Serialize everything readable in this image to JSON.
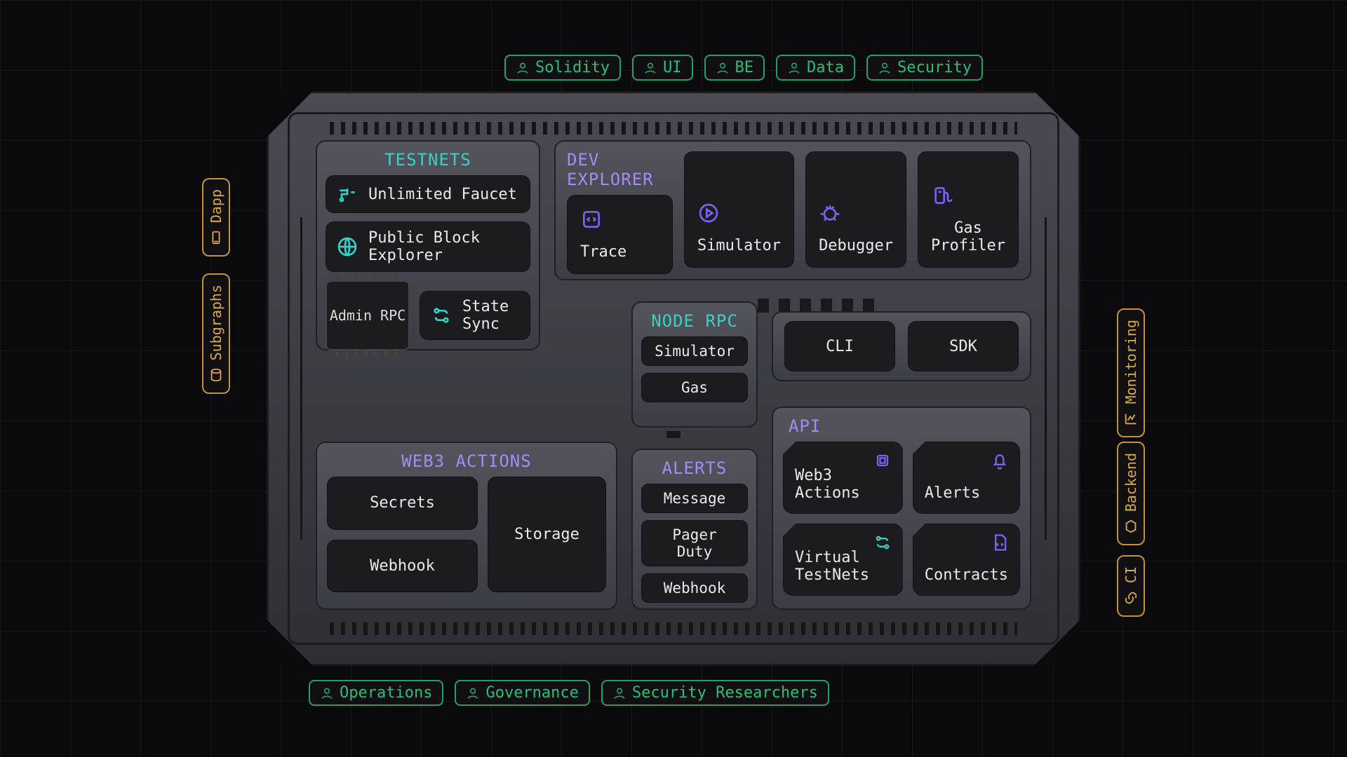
{
  "top_tags": [
    "Solidity",
    "UI",
    "BE",
    "Data",
    "Security"
  ],
  "bottom_tags": [
    "Operations",
    "Governance",
    "Security Researchers"
  ],
  "left_pills": [
    {
      "label": "Dapp",
      "icon": "device"
    },
    {
      "label": "Subgraphs",
      "icon": "db"
    }
  ],
  "right_pills": [
    {
      "label": "Monitoring",
      "icon": "chart"
    },
    {
      "label": "Backend",
      "icon": "hex"
    },
    {
      "label": "CI",
      "icon": "link"
    }
  ],
  "testnets": {
    "title": "TESTNETS",
    "items": [
      "Unlimited Faucet",
      "Public Block Explorer"
    ],
    "admin_rpc": "Admin RPC",
    "state_sync": "State Sync"
  },
  "devexp": {
    "title": "DEV EXPLORER",
    "trace": "Trace",
    "items": [
      "Simulator",
      "Debugger",
      "Gas Profiler"
    ]
  },
  "node": {
    "title": "NODE RPC",
    "items": [
      "Simulator",
      "Gas"
    ],
    "side": [
      "CLI",
      "SDK"
    ]
  },
  "web3": {
    "title": "WEB3 ACTIONS",
    "items": [
      "Secrets",
      "Webhook",
      "Storage"
    ]
  },
  "alerts": {
    "title": "ALERTS",
    "items": [
      "Message",
      "Pager Duty",
      "Webhook"
    ]
  },
  "api": {
    "title": "API",
    "items": [
      {
        "label": "Web3 Actions",
        "icon": "cpu",
        "color": "violet"
      },
      {
        "label": "Alerts",
        "icon": "bell",
        "color": "violet"
      },
      {
        "label": "Virtual TestNets",
        "icon": "sync",
        "color": "teal"
      },
      {
        "label": "Contracts",
        "icon": "file",
        "color": "violet"
      }
    ]
  }
}
